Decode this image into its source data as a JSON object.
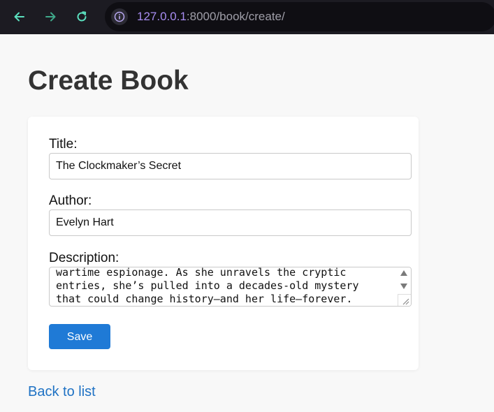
{
  "browser": {
    "url_host": "127.0.0.1",
    "url_rest": ":8000/book/create/",
    "back_icon": "arrow-left-icon",
    "forward_icon": "arrow-right-icon",
    "reload_icon": "reload-icon",
    "info_icon": "info-icon",
    "nav_color": "#5be0bf"
  },
  "page": {
    "title": "Create Book",
    "back_link": "Back to list"
  },
  "form": {
    "title_label": "Title:",
    "title_value": "The Clockmaker’s Secret",
    "author_label": "Author:",
    "author_value": "Evelyn Hart",
    "description_label": "Description:",
    "description_lines": [
      "wartime espionage. As she unravels the cryptic",
      "entries, she’s pulled into a decades-old mystery",
      "that could change history—and her life—forever."
    ],
    "save_label": "Save"
  },
  "colors": {
    "accent": "#1f7ad6",
    "link": "#1f72c4",
    "url_host": "#a78cf0"
  }
}
